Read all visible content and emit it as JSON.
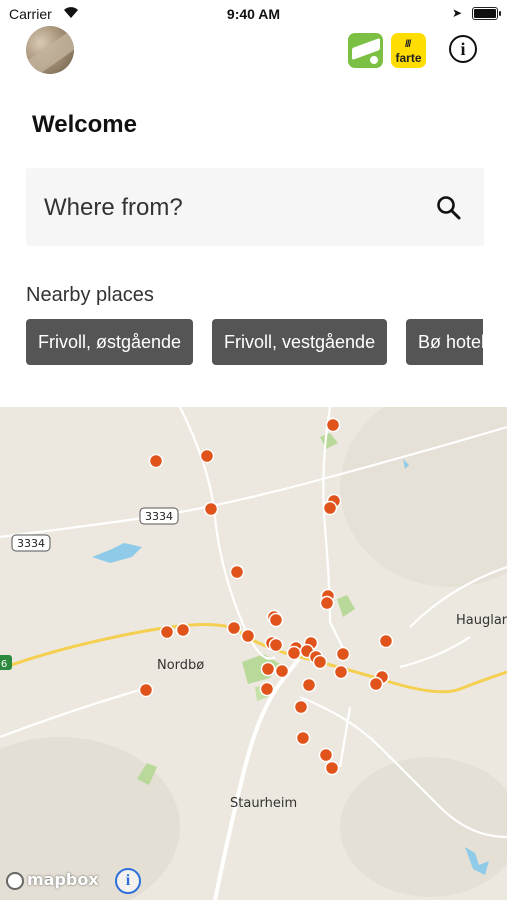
{
  "status_bar": {
    "carrier": "Carrier",
    "time": "9:40 AM"
  },
  "header": {
    "app_icons": [
      {
        "name": "green-app-icon",
        "color": "#7bc043"
      },
      {
        "name": "farte-app-icon",
        "label": "farte",
        "color": "#ffdd00"
      }
    ],
    "info_icon": "i"
  },
  "welcome": "Welcome",
  "search": {
    "placeholder": "Where from?"
  },
  "nearby": {
    "title": "Nearby places",
    "places": [
      "Frivoll, østgående",
      "Frivoll, vestgående",
      "Bø hotel"
    ]
  },
  "map": {
    "labels": {
      "nordbo": "Nordbø",
      "staurheim": "Staurheim",
      "hauglar": "Hauglar"
    },
    "road_shields": {
      "r3334a": "3334",
      "r3334b": "3334",
      "r6": "6"
    },
    "attribution": {
      "logo": "mapbox",
      "info": "i"
    },
    "stop_color": "#e0531b"
  }
}
